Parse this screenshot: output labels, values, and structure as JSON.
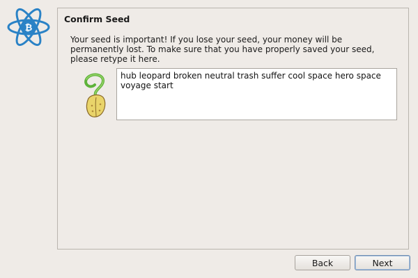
{
  "dialog": {
    "title": "Confirm Seed",
    "message": "Your seed is important! If you lose your seed, your money will be permanently lost. To make sure that you have properly saved your seed, please retype it here.",
    "seed_text": "hub leopard broken neutral trash suffer cool space hero space voyage start"
  },
  "buttons": {
    "back": "Back",
    "next": "Next"
  },
  "icons": {
    "logo": "electrum-bitcoin-atom-logo",
    "seed": "sprouting-seed-icon"
  },
  "colors": {
    "logo_blue": "#2a82c6",
    "background": "#efebe7"
  }
}
